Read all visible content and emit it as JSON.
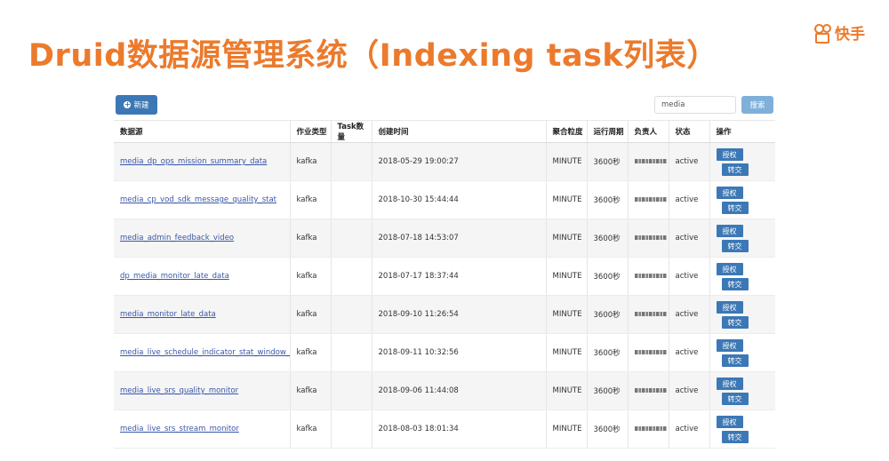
{
  "slide": {
    "title": "Druid数据源管理系统（Indexing task列表）",
    "logo_text": "快手"
  },
  "toolbar": {
    "new_label": "新建",
    "search_value": "media",
    "search_label": "搜索"
  },
  "table": {
    "headers": [
      "数据源",
      "作业类型",
      "Task数量",
      "创建时间",
      "聚合粒度",
      "运行周期",
      "负责人",
      "状态",
      "操作"
    ],
    "action_labels": {
      "authorize": "授权",
      "transfer": "转交"
    },
    "rows": [
      {
        "datasource": "media_dp_ops_mission_summary_data",
        "job_type": "kafka",
        "task_count": "",
        "created": "2018-05-29 19:00:27",
        "granularity": "MINUTE",
        "period": "3600秒",
        "status": "active"
      },
      {
        "datasource": "media_cp_vod_sdk_message_quality_stat",
        "job_type": "kafka",
        "task_count": "",
        "created": "2018-10-30 15:44:44",
        "granularity": "MINUTE",
        "period": "3600秒",
        "status": "active"
      },
      {
        "datasource": "media_admin_feedback_video",
        "job_type": "kafka",
        "task_count": "",
        "created": "2018-07-18 14:53:07",
        "granularity": "MINUTE",
        "period": "3600秒",
        "status": "active"
      },
      {
        "datasource": "dp_media_monitor_late_data",
        "job_type": "kafka",
        "task_count": "",
        "created": "2018-07-17 18:37:44",
        "granularity": "MINUTE",
        "period": "3600秒",
        "status": "active"
      },
      {
        "datasource": "media_monitor_late_data",
        "job_type": "kafka",
        "task_count": "",
        "created": "2018-09-10 11:26:54",
        "granularity": "MINUTE",
        "period": "3600秒",
        "status": "active"
      },
      {
        "datasource": "media_live_schedule_indicator_stat_window_stat",
        "job_type": "kafka",
        "task_count": "",
        "created": "2018-09-11 10:32:56",
        "granularity": "MINUTE",
        "period": "3600秒",
        "status": "active"
      },
      {
        "datasource": "media_live_srs_quality_monitor",
        "job_type": "kafka",
        "task_count": "",
        "created": "2018-09-06 11:44:08",
        "granularity": "MINUTE",
        "period": "3600秒",
        "status": "active"
      },
      {
        "datasource": "media_live_srs_stream_monitor",
        "job_type": "kafka",
        "task_count": "",
        "created": "2018-08-03 18:01:34",
        "granularity": "MINUTE",
        "period": "3600秒",
        "status": "active"
      }
    ]
  }
}
